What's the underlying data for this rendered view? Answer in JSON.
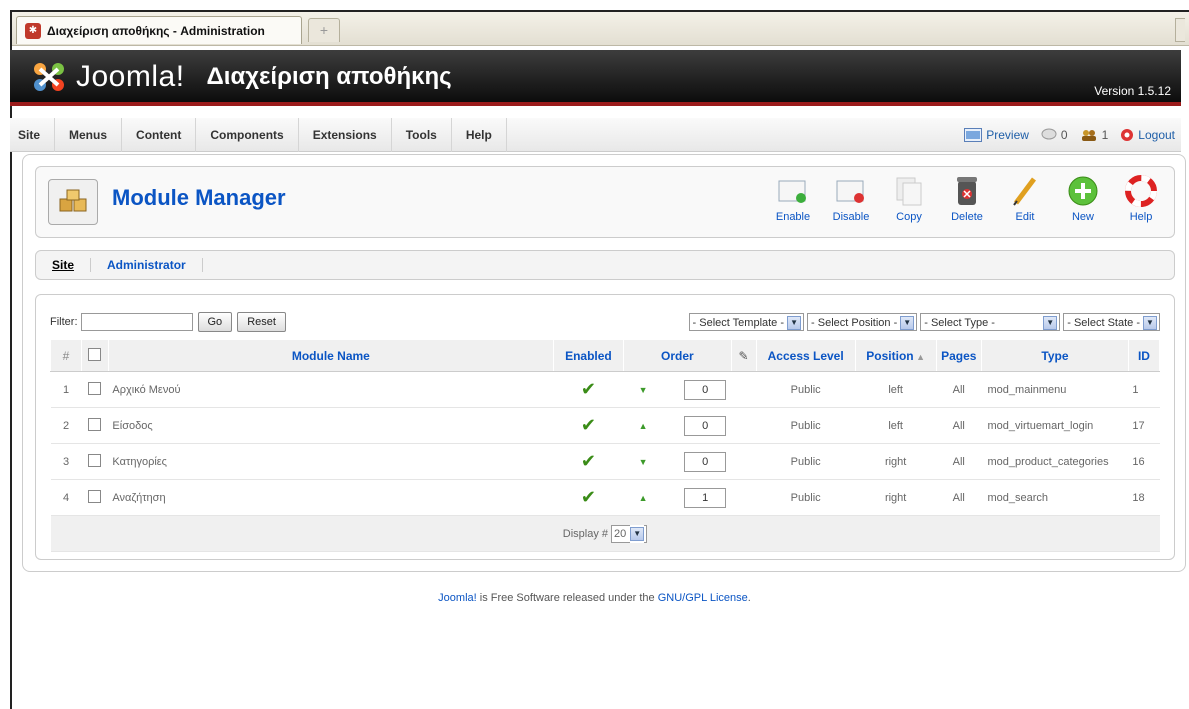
{
  "browser": {
    "tab_title": "Διαχείριση αποθήκης - Administration",
    "new_tab": "+"
  },
  "header": {
    "brand": "Joomla!",
    "site_name": "Διαχείριση αποθήκης",
    "version": "Version 1.5.12"
  },
  "menu": {
    "items": [
      "Site",
      "Menus",
      "Content",
      "Components",
      "Extensions",
      "Tools",
      "Help"
    ],
    "preview": "Preview",
    "messages": "0",
    "users": "1",
    "logout": "Logout"
  },
  "toolbar": {
    "title": "Module Manager",
    "buttons": [
      "Enable",
      "Disable",
      "Copy",
      "Delete",
      "Edit",
      "New",
      "Help"
    ]
  },
  "submenu": {
    "items": [
      "Site",
      "Administrator"
    ],
    "active": "Site"
  },
  "filter": {
    "label": "Filter:",
    "value": "",
    "go": "Go",
    "reset": "Reset",
    "template": "- Select Template -",
    "position": "- Select Position -",
    "type": "- Select Type -",
    "state": "- Select State -"
  },
  "table": {
    "headers": {
      "num": "#",
      "name": "Module Name",
      "enabled": "Enabled",
      "order": "Order",
      "access": "Access Level",
      "position": "Position",
      "pages": "Pages",
      "type": "Type",
      "id": "ID"
    },
    "rows": [
      {
        "num": "1",
        "name": "Αρχικό Μενού",
        "order": "0",
        "access": "Public",
        "position": "left",
        "pages": "All",
        "type": "mod_mainmenu",
        "id": "1"
      },
      {
        "num": "2",
        "name": "Είσοδος",
        "order": "0",
        "access": "Public",
        "position": "left",
        "pages": "All",
        "type": "mod_virtuemart_login",
        "id": "17"
      },
      {
        "num": "3",
        "name": "Κατηγορίες",
        "order": "0",
        "access": "Public",
        "position": "right",
        "pages": "All",
        "type": "mod_product_categories",
        "id": "16"
      },
      {
        "num": "4",
        "name": "Αναζήτηση",
        "order": "1",
        "access": "Public",
        "position": "right",
        "pages": "All",
        "type": "mod_search",
        "id": "18"
      }
    ],
    "display_label": "Display #",
    "display_value": "20"
  },
  "footer": {
    "joomla_link": "Joomla!",
    "text": " is Free Software released under the ",
    "license_link": "GNU/GPL License",
    "end": "."
  }
}
